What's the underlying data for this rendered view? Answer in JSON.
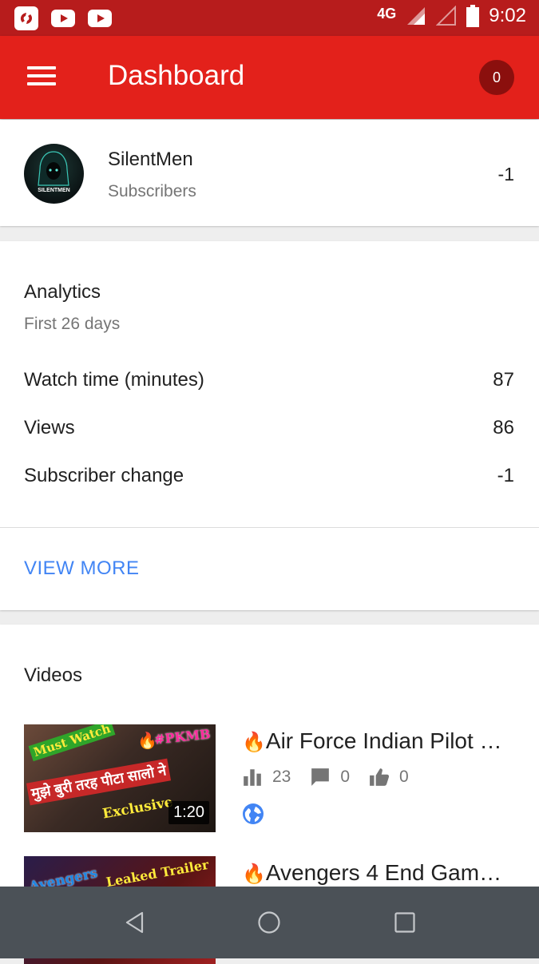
{
  "status_bar": {
    "network": "4G",
    "time": "9:02",
    "icons": [
      "saavn-icon",
      "youtube-icon",
      "youtube-icon",
      "signal-icon",
      "signal-empty-icon",
      "battery-icon"
    ]
  },
  "app_bar": {
    "title": "Dashboard",
    "notifications_count": "0",
    "colors": {
      "app_bar": "#e3211b",
      "status_bar": "#b71c1c",
      "badge": "#8b0f0d"
    }
  },
  "channel": {
    "name": "SilentMen",
    "subscribers_label": "Subscribers",
    "subscribers_value": "-1",
    "avatar_text": "SILENTMEN"
  },
  "analytics": {
    "title": "Analytics",
    "period": "First 26 days",
    "rows": [
      {
        "label": "Watch time (minutes)",
        "value": "87"
      },
      {
        "label": "Views",
        "value": "86"
      },
      {
        "label": "Subscriber change",
        "value": "-1"
      }
    ],
    "view_more": "VIEW MORE",
    "link_color": "#4285f4"
  },
  "videos": {
    "title": "Videos",
    "items": [
      {
        "title": "Air Force Indian Pilot …",
        "views": "23",
        "comments": "0",
        "likes": "0",
        "duration": "1:20",
        "thumb_text": {
          "banner": "Must Watch",
          "tag": "#PKMB",
          "hindi": "मुझे बुरी तरह पीटा सालो ने",
          "exclusive": "Exclusive"
        }
      },
      {
        "title": "Avengers 4 End Gam…",
        "thumb_text": {
          "banner": "Avengers",
          "tag": "Leaked Trailer"
        }
      }
    ]
  },
  "nav_bar": {
    "buttons": [
      "back-icon",
      "home-icon",
      "recents-icon"
    ]
  }
}
